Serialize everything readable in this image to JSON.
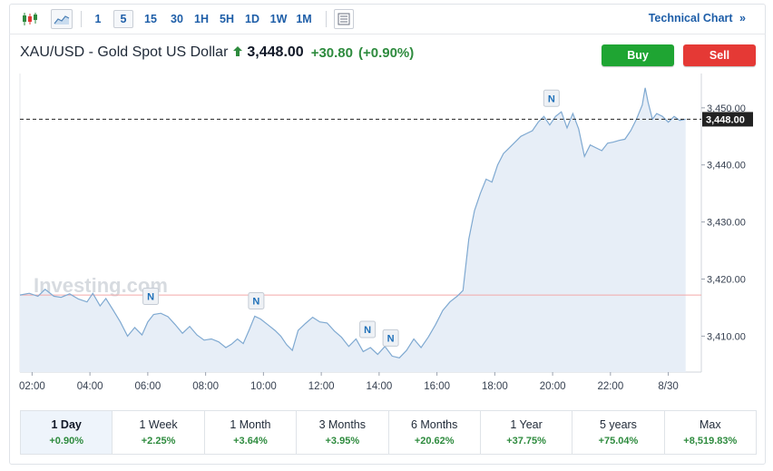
{
  "toolbar": {
    "timeframes": [
      "1",
      "5",
      "15",
      "30",
      "1H",
      "5H",
      "1D",
      "1W",
      "1M"
    ],
    "active_timeframe": "5",
    "technical_chart_label": "Technical Chart",
    "technical_chart_chevron": "»"
  },
  "instrument": {
    "title": "XAU/USD - Gold Spot US Dollar",
    "price": "3,448.00",
    "change": "+30.80",
    "change_pct": "(+0.90%)"
  },
  "actions": {
    "buy_label": "Buy",
    "sell_label": "Sell"
  },
  "colors": {
    "up": "#2e8b3e",
    "buy": "#1fa533",
    "sell": "#e53935",
    "link": "#1e5ea8",
    "line": "#7fa9d1",
    "area": "#e7eef7"
  },
  "chart_data": {
    "type": "area",
    "watermark": "Investing.com",
    "x_ticks": [
      "02:00",
      "04:00",
      "06:00",
      "08:00",
      "10:00",
      "12:00",
      "14:00",
      "16:00",
      "18:00",
      "20:00",
      "22:00",
      "8/30"
    ],
    "y_ticks": [
      "3,450.00",
      "3,440.00",
      "3,430.00",
      "3,420.00",
      "3,410.00"
    ],
    "y_tick_values": [
      3450,
      3440,
      3430,
      3420,
      3410
    ],
    "ylim": [
      3403.7,
      3455.7
    ],
    "x_range_hours": [
      1.58,
      24.86
    ],
    "last_price_label": "3,448.00",
    "last_price": 3448.0,
    "prev_close": 3417.2,
    "news_markers": [
      {
        "label": "N",
        "time": 6.1
      },
      {
        "label": "N",
        "time": 9.75
      },
      {
        "label": "N",
        "time": 13.6
      },
      {
        "label": "N",
        "time": 14.4
      },
      {
        "label": "N",
        "time": 19.96
      }
    ],
    "series": [
      {
        "x": [
          1.58,
          1.9,
          2.2,
          2.45,
          2.75,
          3.0,
          3.3,
          3.6,
          3.9,
          4.1,
          4.35,
          4.55,
          4.8,
          5.05,
          5.3,
          5.55,
          5.8,
          6.0,
          6.2,
          6.45,
          6.7,
          6.95,
          7.2,
          7.45,
          7.7,
          7.95,
          8.2,
          8.45,
          8.7,
          8.9,
          9.1,
          9.3,
          9.5,
          9.7,
          9.9,
          10.15,
          10.4,
          10.6,
          10.8,
          11.0,
          11.2,
          11.45,
          11.7,
          11.95,
          12.2,
          12.45,
          12.7,
          12.95,
          13.2,
          13.45,
          13.7,
          13.95,
          14.2,
          14.45,
          14.7,
          14.95,
          15.2,
          15.45,
          15.7,
          15.95,
          16.2,
          16.45,
          16.7,
          16.9,
          17.1,
          17.3,
          17.5,
          17.7,
          17.9,
          18.1,
          18.3,
          18.5,
          18.7,
          18.9,
          19.1,
          19.3,
          19.5,
          19.7,
          19.9,
          20.1,
          20.3,
          20.5,
          20.7,
          20.9,
          21.1,
          21.3,
          21.5,
          21.7,
          21.9,
          22.1,
          22.3,
          22.5,
          22.7,
          22.9,
          23.1,
          23.2,
          23.3,
          23.45,
          23.6,
          23.8,
          24.0,
          24.2,
          24.4,
          24.6
        ],
        "y": [
          3417.2,
          3417.5,
          3417.0,
          3418.2,
          3417.0,
          3416.8,
          3417.4,
          3416.5,
          3416.0,
          3417.5,
          3415.3,
          3416.6,
          3414.6,
          3412.5,
          3410.0,
          3411.5,
          3410.2,
          3412.5,
          3413.8,
          3414.0,
          3413.4,
          3412.0,
          3410.5,
          3411.7,
          3410.2,
          3409.3,
          3409.5,
          3409.0,
          3408.0,
          3408.6,
          3409.5,
          3408.7,
          3411.0,
          3413.5,
          3413.0,
          3412.0,
          3411.0,
          3410.0,
          3408.5,
          3407.5,
          3411.0,
          3412.2,
          3413.3,
          3412.5,
          3412.3,
          3410.9,
          3409.8,
          3408.2,
          3409.5,
          3407.3,
          3408.0,
          3406.8,
          3408.2,
          3406.5,
          3406.2,
          3407.5,
          3409.5,
          3408.0,
          3409.8,
          3412.0,
          3414.5,
          3416.0,
          3417.0,
          3418.0,
          3427.0,
          3432.0,
          3435.0,
          3437.5,
          3437.0,
          3440.0,
          3442.0,
          3443.0,
          3444.0,
          3445.0,
          3445.5,
          3446.0,
          3447.5,
          3448.5,
          3447.0,
          3448.5,
          3449.3,
          3446.5,
          3449.0,
          3446.3,
          3441.5,
          3443.5,
          3443.0,
          3442.5,
          3443.8,
          3444.0,
          3444.3,
          3444.5,
          3446.0,
          3448.0,
          3450.5,
          3453.5,
          3451.0,
          3448.0,
          3449.0,
          3448.5,
          3447.5,
          3448.5,
          3447.8,
          3448.0
        ]
      }
    ]
  },
  "periods": [
    {
      "label": "1 Day",
      "value": "+0.90%",
      "active": true
    },
    {
      "label": "1 Week",
      "value": "+2.25%"
    },
    {
      "label": "1 Month",
      "value": "+3.64%"
    },
    {
      "label": "3 Months",
      "value": "+3.95%"
    },
    {
      "label": "6 Months",
      "value": "+20.62%"
    },
    {
      "label": "1 Year",
      "value": "+37.75%"
    },
    {
      "label": "5 years",
      "value": "+75.04%"
    },
    {
      "label": "Max",
      "value": "+8,519.83%"
    }
  ]
}
